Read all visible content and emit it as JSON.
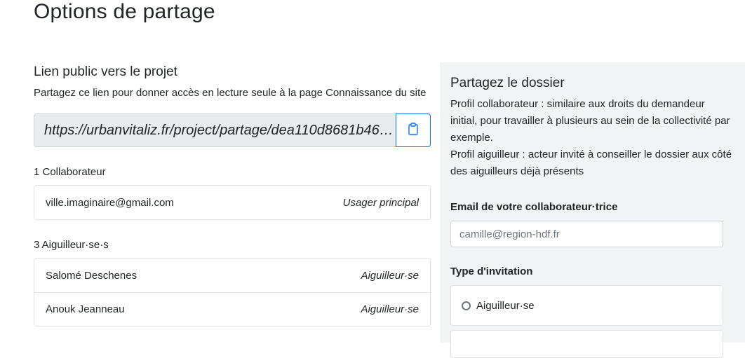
{
  "page": {
    "title": "Options de partage"
  },
  "public_link": {
    "title": "Lien public vers le projet",
    "description": "Partagez ce lien pour donner accès en lecture seule à la page Connaissance du site",
    "url": "https://urbanvitaliz.fr/project/partage/dea110d8681b46…",
    "copy_icon": "clipboard-icon"
  },
  "collaborators": {
    "label": "1 Collaborateur",
    "items": [
      {
        "email": "ville.imaginaire@gmail.com",
        "role": "Usager principal"
      }
    ]
  },
  "advisors": {
    "label": "3 Aiguilleur·se·s",
    "items": [
      {
        "name": "Salomé Deschenes",
        "role": "Aiguilleur·se"
      },
      {
        "name": "Anouk Jeanneau",
        "role": "Aiguilleur·se"
      }
    ]
  },
  "share_panel": {
    "title": "Partagez le dossier",
    "description_1": "Profil collaborateur : similaire aux droits du demandeur initial, pour travailler à plusieurs au sein de la collectivité par exemple.",
    "description_2": "Profil aiguilleur : acteur invité à conseiller le dossier aux côté des aiguilleurs déjà présents",
    "email_label": "Email de votre collaborateur·trice",
    "email_placeholder": "camille@region-hdf.fr",
    "invitation_label": "Type d'invitation",
    "invitation_option_1": "Aiguilleur·se"
  },
  "colors": {
    "accent": "#0d6efd",
    "panel_bg": "#f2f3f5",
    "readonly_bg": "#e9ecef"
  }
}
